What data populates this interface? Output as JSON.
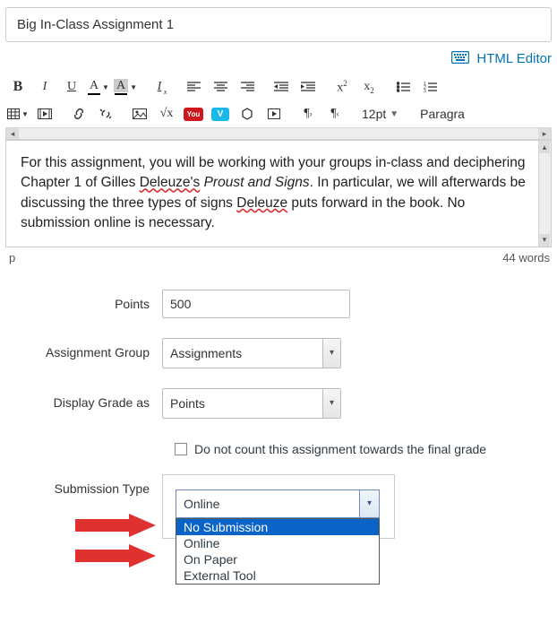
{
  "title": "Big In-Class Assignment 1",
  "html_editor_label": "HTML Editor",
  "toolbar": {
    "font_size": "12pt",
    "paragraph": "Paragra"
  },
  "editor": {
    "text_1": "For this assignment, you will be working with your groups in-class and deciphering Chapter 1 of Gilles ",
    "squig_1": "Deleuze's",
    "text_2": " ",
    "italic": "Proust and Signs",
    "text_3": ". In particular, we will afterwards be discussing the three types of signs ",
    "squig_2": "Deleuze",
    "text_4": " puts forward in the book. No submission online is necessary."
  },
  "status": {
    "path": "p",
    "words": "44 words"
  },
  "form": {
    "points_label": "Points",
    "points_value": "500",
    "group_label": "Assignment Group",
    "group_value": "Assignments",
    "display_label": "Display Grade as",
    "display_value": "Points",
    "nocount_label": "Do not count this assignment towards the final grade",
    "submission_label": "Submission Type",
    "submission_value": "Online",
    "options": {
      "no_submission": "No Submission",
      "online": "Online",
      "on_paper": "On Paper",
      "external": "External Tool"
    }
  }
}
